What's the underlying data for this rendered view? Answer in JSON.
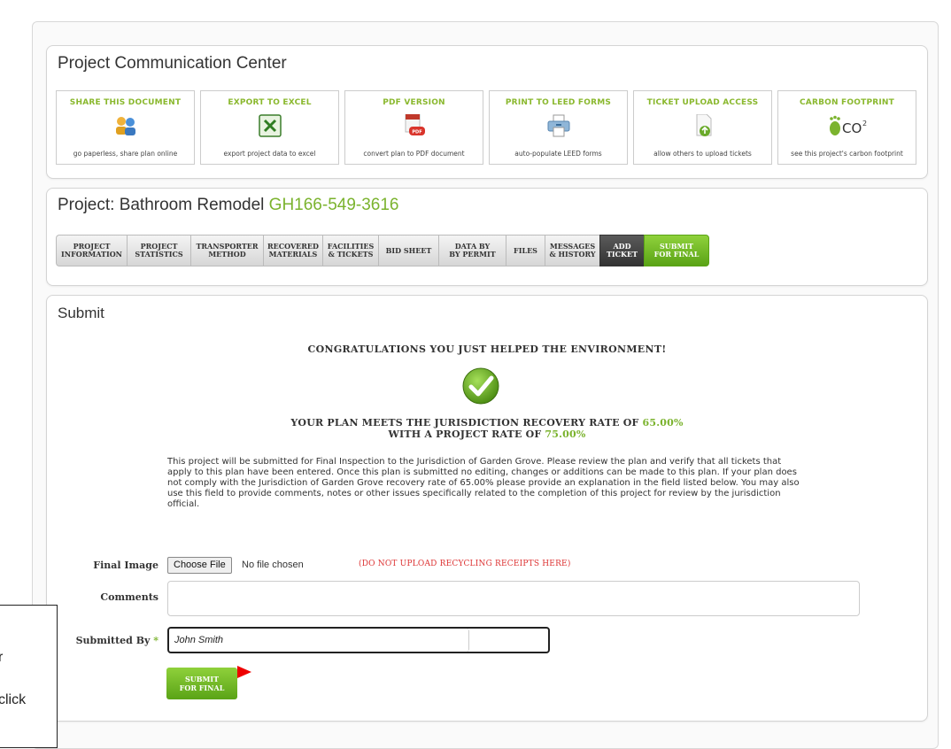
{
  "communication_center": {
    "title": "Project Communication Center",
    "tiles": [
      {
        "title": "SHARE THIS DOCUMENT",
        "desc": "go paperless, share plan online",
        "icon": "users-share-icon"
      },
      {
        "title": "EXPORT TO EXCEL",
        "desc": "export project data to excel",
        "icon": "excel-icon"
      },
      {
        "title": "PDF VERSION",
        "desc": "convert plan to PDF document",
        "icon": "pdf-icon"
      },
      {
        "title": "PRINT TO LEED FORMS",
        "desc": "auto-populate LEED forms",
        "icon": "printer-icon"
      },
      {
        "title": "TICKET UPLOAD ACCESS",
        "desc": "allow others to upload tickets",
        "icon": "upload-document-icon"
      },
      {
        "title": "CARBON FOOTPRINT",
        "desc": "see this project's carbon footprint",
        "icon": "co2-footprint-icon"
      }
    ]
  },
  "project": {
    "title_prefix": "Project: Bathroom Remodel ",
    "code": "GH166-549-3616",
    "tabs": [
      {
        "line1": "PROJECT",
        "line2": "INFORMATION"
      },
      {
        "line1": "PROJECT",
        "line2": "STATISTICS"
      },
      {
        "line1": "TRANSPORTER",
        "line2": "METHOD"
      },
      {
        "line1": "RECOVERED",
        "line2": "MATERIALS"
      },
      {
        "line1": "FACILITIES",
        "line2": "& TICKETS"
      },
      {
        "line1": "BID SHEET",
        "line2": ""
      },
      {
        "line1": "DATA BY",
        "line2": "BY PERMIT"
      },
      {
        "line1": "FILES",
        "line2": ""
      },
      {
        "line1": "MESSAGES",
        "line2": "& HISTORY"
      },
      {
        "line1": "ADD",
        "line2": "TICKET"
      },
      {
        "line1": "SUBMIT",
        "line2": "FOR FINAL"
      }
    ]
  },
  "submit": {
    "title": "Submit",
    "congrats": "CONGRATULATIONS YOU JUST HELPED THE ENVIRONMENT!",
    "meets_prefix": "YOUR PLAN MEETS THE JURISDICTION RECOVERY RATE OF ",
    "jurisdiction_rate": "65.00%",
    "project_rate_prefix": "WITH A PROJECT RATE OF ",
    "project_rate": "75.00%",
    "paragraph": "This project will be submitted for Final Inspection to the Jurisdiction of Garden Grove. Please review the plan and verify that all tickets that apply to this plan have been entered. Once this plan is submitted no editing, changes or additions can be made to this plan. If your plan does not comply with the Jurisdiction of Garden Grove recovery rate of 65.00% please provide an explanation in the field listed below. You may also use this field to provide comments, notes or other issues specifically related to the completion of this project for review by the jurisdiction official.",
    "final_image_label": "Final Image",
    "choose_file": "Choose File",
    "no_file": "No file chosen",
    "warning": "(DO NOT UPLOAD RECYCLING RECEIPTS HERE)",
    "comments_label": "Comments",
    "comments_value": "",
    "submitted_by_label": "Submitted By",
    "required_mark": "*",
    "submitted_by_value": "John Smith",
    "submit_line1": "SUBMIT",
    "submit_line2": "FOR FINAL"
  },
  "callout": {
    "line1": "r",
    "line2": "click"
  },
  "colors": {
    "accent_green": "#7bb32e",
    "warning_red": "#dd3333",
    "arrow_red": "#ee0000"
  }
}
